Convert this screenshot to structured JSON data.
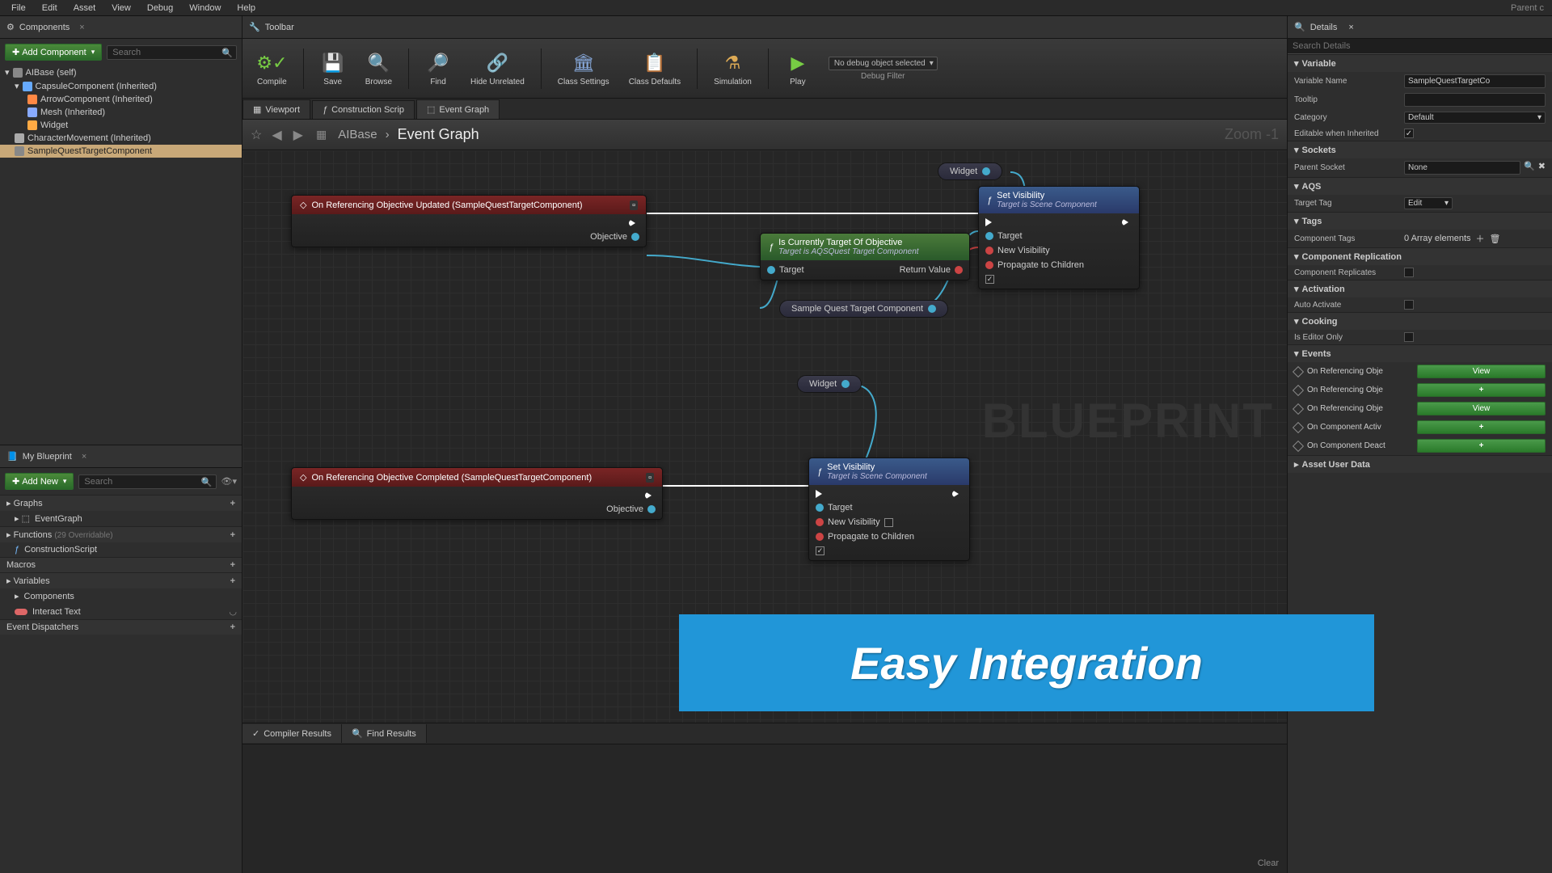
{
  "menu": {
    "items": [
      "File",
      "Edit",
      "Asset",
      "View",
      "Debug",
      "Window",
      "Help"
    ],
    "right": "Parent c"
  },
  "components": {
    "tab": "Components",
    "add": "Add Component",
    "search_ph": "Search",
    "tree": [
      {
        "i": 0,
        "label": "AIBase (self)"
      },
      {
        "i": 1,
        "label": "CapsuleComponent (Inherited)"
      },
      {
        "i": 2,
        "label": "ArrowComponent (Inherited)"
      },
      {
        "i": 2,
        "label": "Mesh (Inherited)"
      },
      {
        "i": 2,
        "label": "Widget"
      },
      {
        "i": 1,
        "label": "CharacterMovement (Inherited)"
      },
      {
        "i": 1,
        "label": "SampleQuestTargetComponent",
        "sel": true
      }
    ]
  },
  "myblueprint": {
    "tab": "My Blueprint",
    "add": "Add New",
    "search_ph": "Search",
    "graphs": "Graphs",
    "eventgraph": "EventGraph",
    "functions": "Functions",
    "fcount": "(29 Overridable)",
    "construction": "ConstructionScript",
    "macros": "Macros",
    "variables": "Variables",
    "components_var": "Components",
    "interact": "Interact Text",
    "dispatch": "Event Dispatchers"
  },
  "toolbar": {
    "tab": "Toolbar",
    "compile": "Compile",
    "save": "Save",
    "browse": "Browse",
    "find": "Find",
    "hide": "Hide Unrelated",
    "settings": "Class Settings",
    "defaults": "Class Defaults",
    "sim": "Simulation",
    "play": "Play",
    "debug_sel": "No debug object selected",
    "debug_lbl": "Debug Filter"
  },
  "gtabs": {
    "viewport": "Viewport",
    "construction": "Construction Scrip",
    "eventgraph": "Event Graph"
  },
  "bc": {
    "root": "AIBase",
    "sep": "›",
    "cur": "Event Graph",
    "zoom": "Zoom -1"
  },
  "nodes": {
    "ev1": "On Referencing Objective Updated (SampleQuestTargetComponent)",
    "ev2": "On Referencing Objective Completed (SampleQuestTargetComponent)",
    "objective": "Objective",
    "fn_head": "Is Currently Target Of Objective",
    "fn_sub": "Target is AQSQuest Target Component",
    "target": "Target",
    "return": "Return Value",
    "setv": "Set Visibility",
    "setv_sub": "Target is Scene Component",
    "newvis": "New Visibility",
    "prop": "Propagate to Children",
    "widget": "Widget",
    "sample": "Sample Quest Target Component"
  },
  "watermark": "BLUEPRINT",
  "results": {
    "compiler": "Compiler Results",
    "find": "Find Results",
    "clear": "Clear"
  },
  "details": {
    "tab": "Details",
    "search_ph": "Search Details",
    "variable": {
      "head": "Variable",
      "name_l": "Variable Name",
      "name_v": "SampleQuestTargetCo",
      "tooltip_l": "Tooltip",
      "cat_l": "Category",
      "cat_v": "Default",
      "edit_l": "Editable when Inherited"
    },
    "sockets": {
      "head": "Sockets",
      "parent_l": "Parent Socket",
      "parent_v": "None"
    },
    "aqs": {
      "head": "AQS",
      "tag_l": "Target Tag",
      "tag_v": "Edit"
    },
    "tags": {
      "head": "Tags",
      "ctags_l": "Component Tags",
      "ctags_v": "0 Array elements"
    },
    "rep": {
      "head": "Component Replication",
      "crep_l": "Component Replicates"
    },
    "act": {
      "head": "Activation",
      "auto_l": "Auto Activate"
    },
    "cook": {
      "head": "Cooking",
      "editor_l": "Is Editor Only"
    },
    "events": {
      "head": "Events",
      "rows": [
        {
          "l": "On Referencing Obje",
          "b": "View"
        },
        {
          "l": "On Referencing Obje",
          "b": "+"
        },
        {
          "l": "On Referencing Obje",
          "b": "View"
        },
        {
          "l": "On Component Activ",
          "b": "+"
        },
        {
          "l": "On Component Deact",
          "b": "+"
        }
      ]
    },
    "asset": "Asset User Data"
  },
  "banner": "Easy Integration"
}
